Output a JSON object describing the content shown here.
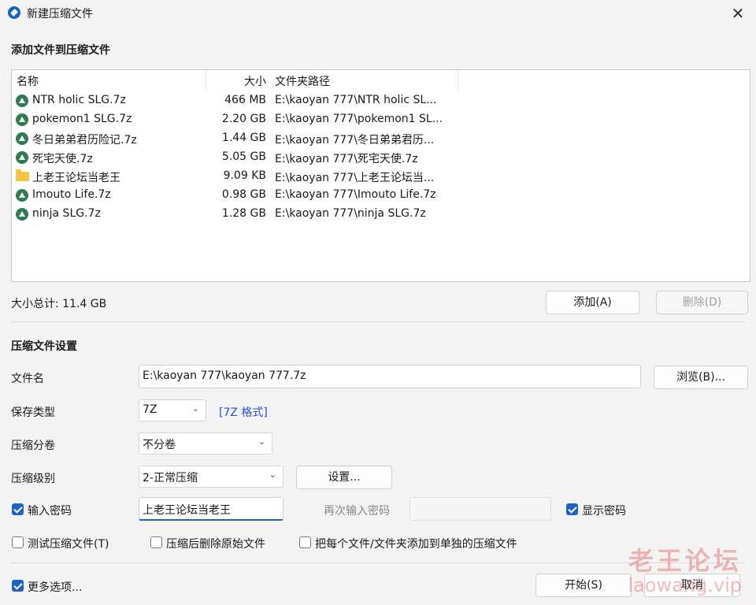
{
  "window": {
    "title": "新建压缩文件",
    "close": "✕"
  },
  "add_section": {
    "title": "添加文件到压缩文件",
    "columns": {
      "name": "名称",
      "size": "大小",
      "path": "文件夹路径"
    },
    "files": [
      {
        "icon": "7z-archive-icon",
        "name": "NTR holic SLG.7z",
        "size": "466 MB",
        "path": "E:\\kaoyan 777\\NTR holic SL..."
      },
      {
        "icon": "7z-archive-icon",
        "name": "pokemon1 SLG.7z",
        "size": "2.20 GB",
        "path": "E:\\kaoyan 777\\pokemon1 SL..."
      },
      {
        "icon": "7z-archive-icon",
        "name": "冬日弟弟君历险记.7z",
        "size": "1.44 GB",
        "path": "E:\\kaoyan 777\\冬日弟弟君历..."
      },
      {
        "icon": "7z-archive-icon",
        "name": "死宅天使.7z",
        "size": "5.05 GB",
        "path": "E:\\kaoyan 777\\死宅天使.7z"
      },
      {
        "icon": "folder-icon",
        "name": "上老王论坛当老王",
        "size": "9.09 KB",
        "path": "E:\\kaoyan 777\\上老王论坛当..."
      },
      {
        "icon": "7z-archive-icon",
        "name": "Imouto Life.7z",
        "size": "0.98 GB",
        "path": "E:\\kaoyan 777\\Imouto Life.7z"
      },
      {
        "icon": "7z-archive-icon",
        "name": "ninja SLG.7z",
        "size": "1.28 GB",
        "path": "E:\\kaoyan 777\\ninja SLG.7z"
      }
    ],
    "total": "大小总计: 11.4 GB",
    "add_button": "添加(A)",
    "delete_button": "删除(D)"
  },
  "settings": {
    "title": "压缩文件设置",
    "filename_label": "文件名",
    "filename_value": "E:\\kaoyan 777\\kaoyan 777.7z",
    "browse_button": "浏览(B)...",
    "type_label": "保存类型",
    "type_value": "7Z",
    "type_link": "[7Z 格式]",
    "split_label": "压缩分卷",
    "split_value": "不分卷",
    "level_label": "压缩级别",
    "level_value": "2-正常压缩",
    "settings_button": "设置...",
    "password_checkbox": "输入密码",
    "password_value": "上老王论坛当老王",
    "reenter_label": "再次输入密码",
    "reenter_value": "",
    "show_password": "显示密码",
    "test_archive": "测试压缩文件(T)",
    "delete_after": "压缩后删除原始文件",
    "separate_archives": "把每个文件/文件夹添加到单独的压缩文件"
  },
  "footer": {
    "more_options": "更多选项...",
    "start_button": "开始(S)",
    "cancel_button": "取消"
  },
  "watermark": {
    "line1": "老王论坛",
    "line2": "laowang.vip"
  },
  "checkbox_states": {
    "password": true,
    "show_password": true,
    "test_archive": false,
    "delete_after": false,
    "separate_archives": false,
    "more_options": true
  },
  "colors": {
    "accent": "#1f62c7",
    "archive_icon": "#2e7d4f",
    "folder": "#f5c542",
    "link": "#2a4fd6"
  }
}
